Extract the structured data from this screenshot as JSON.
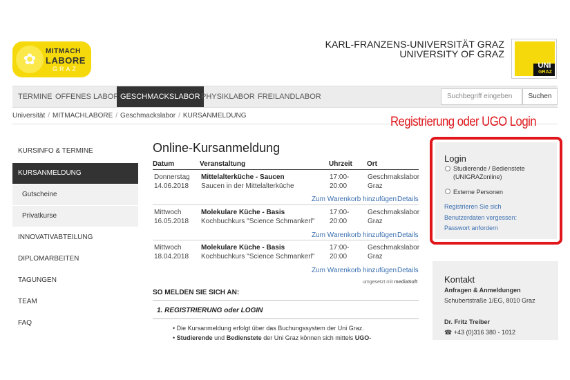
{
  "logo": {
    "line1": "MITMACH",
    "line2": "LABORE",
    "line3": "GRAZ"
  },
  "university": {
    "name_de": "KARL-FRANZENS-UNIVERSITÄT GRAZ",
    "name_en": "UNIVERSITY OF GRAZ",
    "logo_text1": "UNI",
    "logo_text2": "GRAZ"
  },
  "nav": {
    "items": [
      {
        "label": "TERMINE"
      },
      {
        "label": "OFFENES LABOR"
      },
      {
        "label": "GESCHMACKSLABOR"
      },
      {
        "label": "PHYSIKLABOR"
      },
      {
        "label": "FREILANDLABOR"
      }
    ],
    "active": "GESCHMACKSLABOR"
  },
  "search": {
    "placeholder": "Suchbegriff eingeben",
    "button": "Suchen"
  },
  "breadcrumb": [
    "Universität",
    "MITMACHLABORE",
    "Geschmackslabor",
    "KURSANMELDUNG"
  ],
  "annotation": "Registrierung oder UGO Login",
  "sidebar": {
    "items": [
      {
        "label": "KURSINFO & TERMINE"
      },
      {
        "label": "KURSANMELDUNG"
      },
      {
        "label": "Gutscheine"
      },
      {
        "label": "Privatkurse"
      },
      {
        "label": "INNOVATIVABTEILUNG"
      },
      {
        "label": "DIPLOMARBEITEN"
      },
      {
        "label": "TAGUNGEN"
      },
      {
        "label": "TEAM"
      },
      {
        "label": "FAQ"
      }
    ]
  },
  "main": {
    "title": "Online-Kursanmeldung",
    "headers": [
      "Datum",
      "Veranstaltung",
      "Uhrzeit",
      "Ort"
    ],
    "rows": [
      {
        "day": "Donnerstag",
        "date": "14.06.2018",
        "title": "Mittelalterküche - Saucen",
        "subtitle": "Saucen in der Mittelalterküche",
        "time_from": "17:00-",
        "time_to": "20:00",
        "place1": "Geschmakslabor",
        "place2": "Graz",
        "cart": "Zum Warenkorb hinzufügen",
        "details": "Details"
      },
      {
        "day": "Mittwoch",
        "date": "16.05.2018",
        "title": "Molekulare Küche - Basis",
        "subtitle": "Kochbuchkurs \"Science Schmankerl\"",
        "time_from": "17:00-",
        "time_to": "20:00",
        "place1": "Geschmakslabor",
        "place2": "Graz",
        "cart": "Zum Warenkorb hinzufügen",
        "details": "Details"
      },
      {
        "day": "Mittwoch",
        "date": "18.04.2018",
        "title": "Molekulare Küche - Basis",
        "subtitle": "Kochbuchkurs \"Science Schmankerl\"",
        "time_from": "17:00-",
        "time_to": "20:00",
        "place1": "Geschmakslabor",
        "place2": "Graz",
        "cart": "Zum Warenkorb hinzufügen",
        "details": "Details"
      }
    ],
    "powered_by": "umgesetzt mit",
    "powered_brand": "mediaSoft",
    "section_heading": "SO MELDEN SIE SICH AN:",
    "step1": "1. REGISTRIERUNG oder LOGIN",
    "bullet1": "Die Kursanmeldung erfolgt über das Buchungssystem der Uni Graz.",
    "bullet2_a": "Studierende",
    "bullet2_b": " und ",
    "bullet2_c": "Bedienstete",
    "bullet2_d": " der Uni Graz können sich mittels ",
    "bullet2_e": "UGO-"
  },
  "login": {
    "title": "Login",
    "option1_line1": "Studierende / Bedienstete",
    "option1_line2": "(UNIGRAZonline)",
    "option2": "Externe Personen",
    "link1": "Registrieren Sie sich",
    "link2": "Benutzerdaten vergessen:",
    "link3": "Passwort anfordern"
  },
  "kontakt": {
    "title": "Kontakt",
    "subtitle": "Anfragen & Anmeldungen",
    "address": "Schubertstraße 1/EG, 8010 Graz",
    "person": "Dr. Fritz Treiber",
    "phone": "+43 (0)316 380 - 1012"
  },
  "colors": {
    "brand_yellow": "#f5d90a",
    "annotation_red": "#e0161b",
    "link_blue": "#3a6fb0",
    "nav_active": "#333333"
  }
}
